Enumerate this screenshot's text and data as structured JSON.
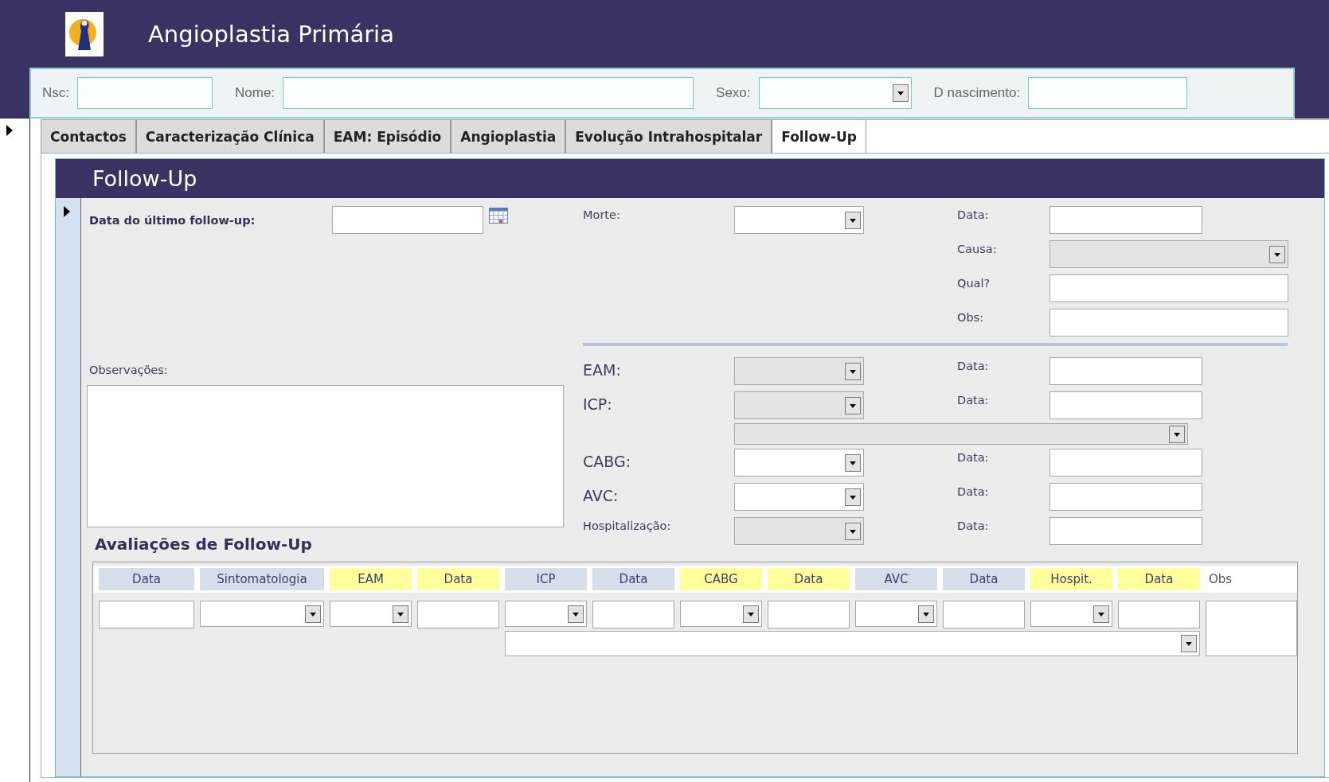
{
  "window": {
    "title": "Angioplastia Primária"
  },
  "patient_fields": [
    {
      "label": "Nsc:",
      "kind": "text"
    },
    {
      "label": "Nome:",
      "kind": "text"
    },
    {
      "label": "Sexo:",
      "kind": "combo"
    },
    {
      "label": "D nascimento:",
      "kind": "text"
    }
  ],
  "tabs": [
    {
      "label": "Contactos",
      "selected": false
    },
    {
      "label": "Caracterização Clínica",
      "selected": false
    },
    {
      "label": "EAM: Episódio",
      "selected": false
    },
    {
      "label": "Angioplastia",
      "selected": false
    },
    {
      "label": "Evolução Intrahospitalar",
      "selected": false
    },
    {
      "label": "Follow-Up",
      "selected": true
    }
  ],
  "section": {
    "title": "Follow-Up"
  },
  "last_follow_up": {
    "label": "Data do último follow-up:"
  },
  "death": {
    "label": "Morte:",
    "disabled": false,
    "date_label": "Data:",
    "details": [
      {
        "label": "Causa:",
        "kind": "combo",
        "disabled": true
      },
      {
        "label": "Qual?",
        "kind": "text",
        "disabled": false
      },
      {
        "label": "Obs:",
        "kind": "text",
        "disabled": false
      }
    ]
  },
  "events": [
    {
      "label": "EAM:",
      "large": true,
      "disabled": true,
      "date_label": "Data:"
    },
    {
      "label": "ICP:",
      "large": true,
      "disabled": true,
      "date_label": "Data:",
      "extra_combo": {
        "disabled": true
      }
    },
    {
      "label": "CABG:",
      "large": true,
      "disabled": false,
      "date_label": "Data:"
    },
    {
      "label": "AVC:",
      "large": true,
      "disabled": false,
      "date_label": "Data:"
    },
    {
      "label": "Hospitalização:",
      "large": false,
      "disabled": true,
      "date_label": "Data:"
    }
  ],
  "observations": {
    "label": "Observações:"
  },
  "assessments": {
    "title": "Avaliações de Follow-Up",
    "detail_combo": {
      "disabled": false
    },
    "columns": [
      {
        "label": "Data",
        "color": "#d5deeb",
        "kind": "text"
      },
      {
        "label": "Sintomatologia",
        "color": "#d5deeb",
        "kind": "combo"
      },
      {
        "label": "EAM",
        "color": "#ffff9c",
        "kind": "combo"
      },
      {
        "label": "Data",
        "color": "#ffff9c",
        "kind": "text"
      },
      {
        "label": "ICP",
        "color": "#d5deeb",
        "kind": "combo"
      },
      {
        "label": "Data",
        "color": "#d5deeb",
        "kind": "text"
      },
      {
        "label": "CABG",
        "color": "#ffff9c",
        "kind": "combo"
      },
      {
        "label": "Data",
        "color": "#ffff9c",
        "kind": "text"
      },
      {
        "label": "AVC",
        "color": "#d5deeb",
        "kind": "combo"
      },
      {
        "label": "Data",
        "color": "#d5deeb",
        "kind": "text"
      },
      {
        "label": "Hospit.",
        "color": "#ffff9c",
        "kind": "combo"
      },
      {
        "label": "Data",
        "color": "#ffff9c",
        "kind": "text"
      },
      {
        "label": "Obs",
        "kind": "memo"
      }
    ]
  }
}
